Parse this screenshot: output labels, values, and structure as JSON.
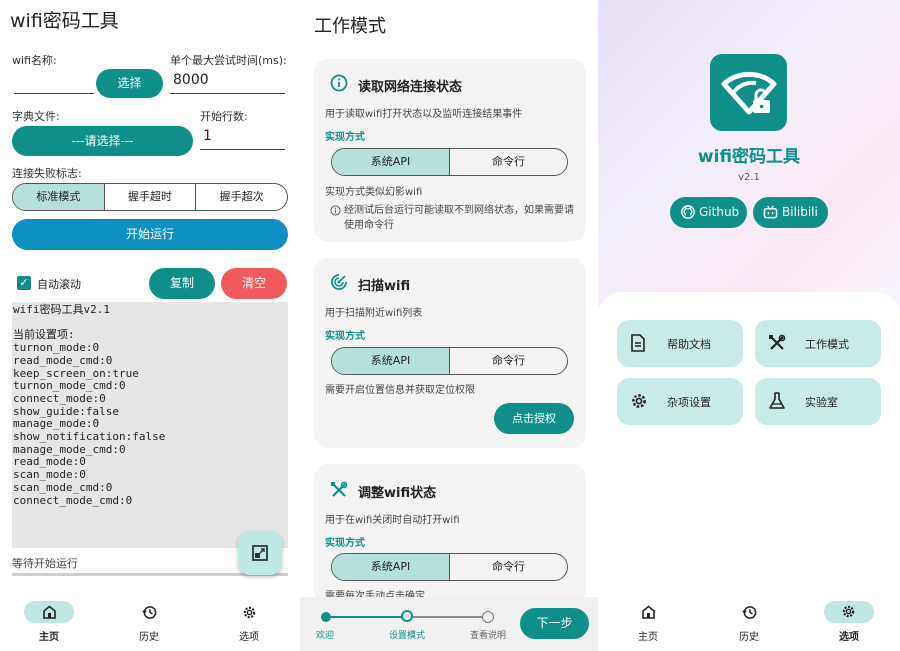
{
  "panel1": {
    "title": "wifi密码工具",
    "wifi_name_label": "wifi名称:",
    "wifi_name_value": "",
    "select_button": "选择",
    "max_time_label": "单个最大尝试时间(ms):",
    "max_time_value": "8000",
    "dict_label": "字典文件:",
    "dict_button": "---请选择---",
    "start_line_label": "开始行数:",
    "start_line_value": "1",
    "fail_label": "连接失败标志:",
    "fail_modes": [
      "标准模式",
      "握手超时",
      "握手超次"
    ],
    "start_button": "开始运行",
    "autoscroll_label": "自动滚动",
    "copy_button": "复制",
    "clear_button": "清空",
    "log_lines": [
      "wifi密码工具v2.1",
      "",
      "当前设置项:",
      "turnon_mode:0",
      "read_mode_cmd:0",
      "keep_screen_on:true",
      "turnon_mode_cmd:0",
      "connect_mode:0",
      "show_guide:false",
      "manage_mode:0",
      "show_notification:false",
      "manage_mode_cmd:0",
      "read_mode:0",
      "scan_mode:0",
      "scan_mode_cmd:0",
      "connect_mode_cmd:0"
    ],
    "status": "等待开始运行",
    "nav": [
      "主页",
      "历史",
      "选项"
    ]
  },
  "panel2": {
    "title": "工作模式",
    "card1": {
      "title": "读取网络连接状态",
      "desc": "用于读取wifi打开状态以及监听连接结果事件",
      "impl_label": "实现方式",
      "options": [
        "系统API",
        "命令行"
      ],
      "note": "实现方式类似幻影wifi",
      "info": "经测试后台运行可能读取不到网络状态，如果需要请使用命令行"
    },
    "card2": {
      "title": "扫描wifi",
      "desc": "用于扫描附近wifi列表",
      "impl_label": "实现方式",
      "options": [
        "系统API",
        "命令行"
      ],
      "note": "需要开启位置信息并获取定位权限",
      "auth_button": "点击授权"
    },
    "card3": {
      "title": "调整wifi状态",
      "desc": "用于在wifi关闭时自动打开wifi",
      "impl_label": "实现方式",
      "options": [
        "系统API",
        "命令行"
      ],
      "note": "需要每次手动点击确定"
    },
    "steps": [
      "欢迎",
      "设置模式",
      "查看说明"
    ],
    "next_button": "下一步"
  },
  "panel3": {
    "app_name": "wifi密码工具",
    "version": "v2.1",
    "github_label": "Github",
    "bilibili_label": "Bilibili",
    "menu": [
      "帮助文档",
      "工作模式",
      "杂项设置",
      "实验室"
    ],
    "nav": [
      "主页",
      "历史",
      "选项"
    ]
  },
  "colors": {
    "accent": "#108f8a",
    "danger": "#f05a5a",
    "log_bg": "#e6e6e6",
    "seg_selected": "#b5e0dc"
  }
}
